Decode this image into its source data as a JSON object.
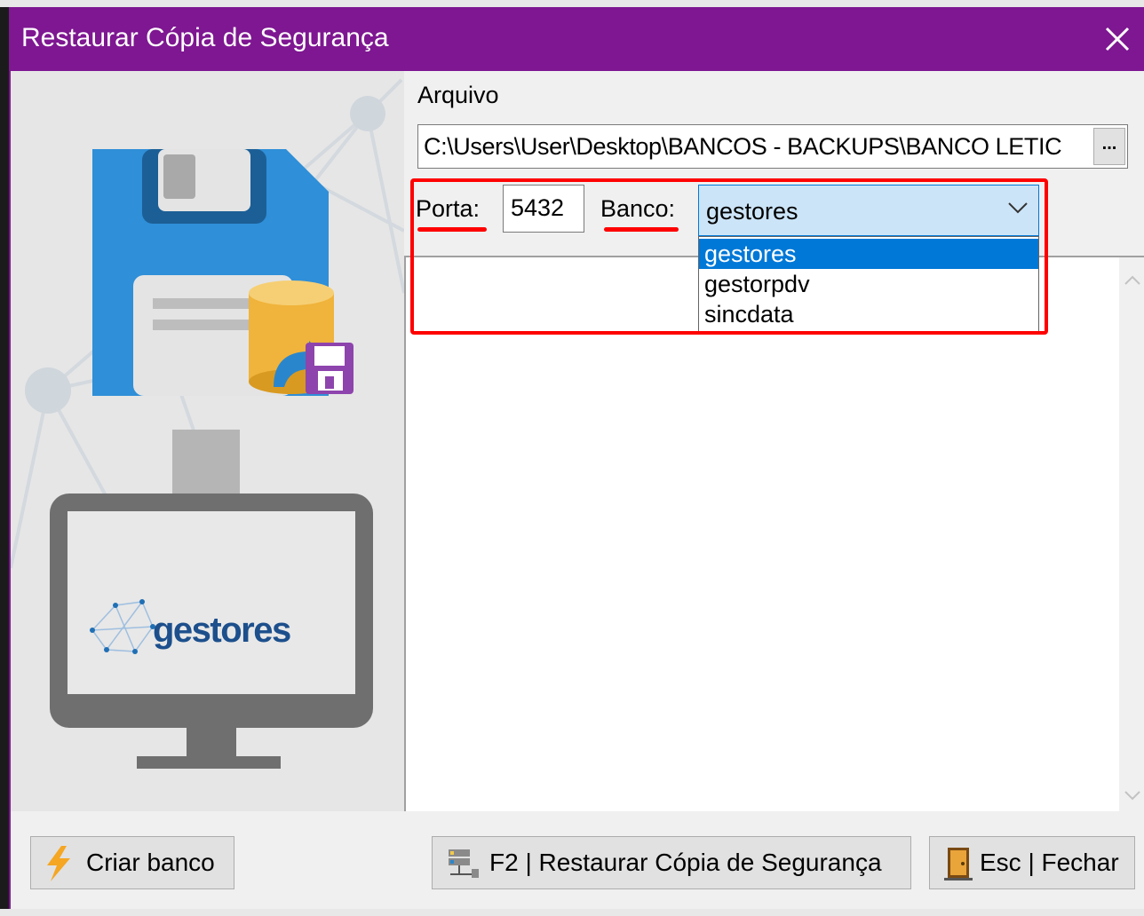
{
  "window": {
    "title": "Restaurar Cópia de Segurança",
    "close_icon": "close-icon",
    "title_bar_color": "#7e1791"
  },
  "form": {
    "arquivo_label": "Arquivo",
    "arquivo_value": "C:\\Users\\User\\Desktop\\BANCOS - BACKUPS\\BANCO LETIC",
    "browse_label": "...",
    "porta_label": "Porta:",
    "porta_value": "5432",
    "banco_label": "Banco:",
    "banco_selected": "gestores",
    "banco_options": [
      "gestores",
      "gestorpdv",
      "sincdata"
    ]
  },
  "branding": {
    "logo_text": "gestores"
  },
  "buttons": {
    "criar_banco": "Criar banco",
    "restaurar": "F2 | Restaurar Cópia de Segurança",
    "fechar": "Esc | Fechar"
  },
  "colors": {
    "highlight": "#ff0000",
    "selection": "#0078d7",
    "combo_bg": "#cce4f7"
  }
}
